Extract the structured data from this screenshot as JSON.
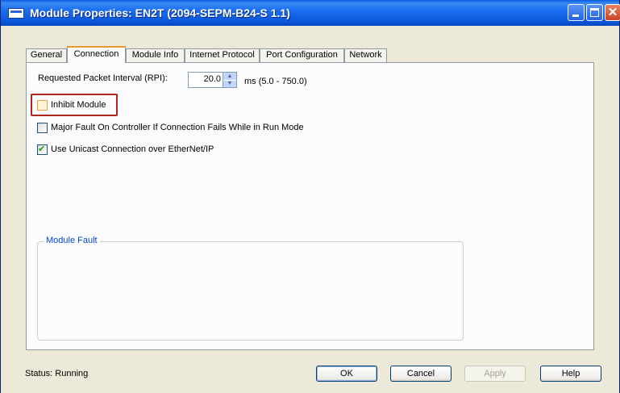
{
  "window": {
    "title": "Module Properties: EN2T (2094-SEPM-B24-S 1.1)"
  },
  "tabs": [
    {
      "label": "General",
      "active": false
    },
    {
      "label": "Connection",
      "active": true
    },
    {
      "label": "Module Info",
      "active": false
    },
    {
      "label": "Internet Protocol",
      "active": false
    },
    {
      "label": "Port Configuration",
      "active": false
    },
    {
      "label": "Network",
      "active": false
    }
  ],
  "connection": {
    "rpi_label": "Requested Packet Interval (RPI):",
    "rpi_value": "20.0",
    "rpi_range": "ms (5.0 - 750.0)",
    "inhibit_label": "Inhibit Module",
    "inhibit_checked": false,
    "major_fault_label": "Major Fault On Controller If Connection Fails While in Run Mode",
    "major_fault_checked": false,
    "unicast_label": "Use Unicast Connection over EtherNet/IP",
    "unicast_checked": true,
    "module_fault_title": "Module Fault"
  },
  "footer": {
    "status": "Status:  Running",
    "ok_label": "OK",
    "cancel_label": "Cancel",
    "apply_label": "Apply",
    "help_label": "Help"
  },
  "colors": {
    "title_bar": "#0a5de0",
    "highlight_border": "#b1251f",
    "group_title": "#0046d5",
    "active_tab_accent": "#e69b2c"
  }
}
